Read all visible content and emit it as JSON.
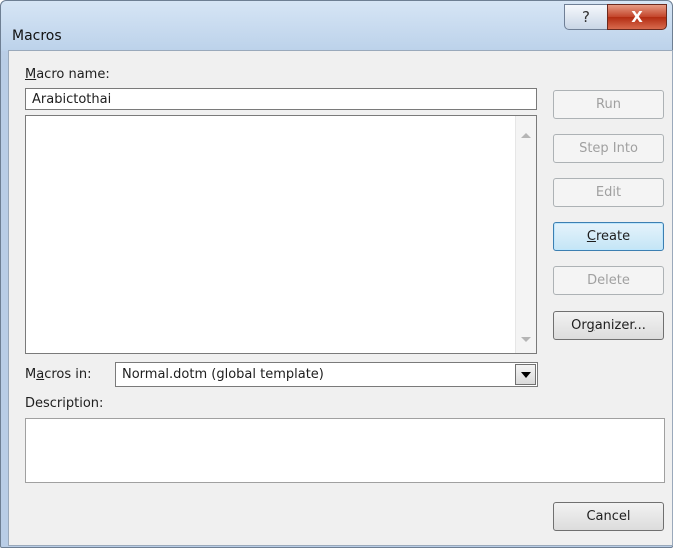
{
  "window": {
    "title": "Macros",
    "help_glyph": "?",
    "close_glyph": "X"
  },
  "macro_name": {
    "label_accel": "M",
    "label_rest": "acro name:",
    "value": "Arabictothai"
  },
  "macro_list": {
    "items": []
  },
  "buttons": {
    "run": "Run",
    "step_into": "Step Into",
    "edit": "Edit",
    "create_accel": "C",
    "create_rest": "reate",
    "delete": "Delete",
    "organizer_pre": "Or",
    "organizer_accel": "g",
    "organizer_rest": "anizer...",
    "cancel": "Cancel"
  },
  "macros_in": {
    "label_pre": "M",
    "label_accel": "a",
    "label_rest": "cros in:",
    "selected": "Normal.dotm (global template)"
  },
  "description": {
    "label": "Description:",
    "value": ""
  }
}
